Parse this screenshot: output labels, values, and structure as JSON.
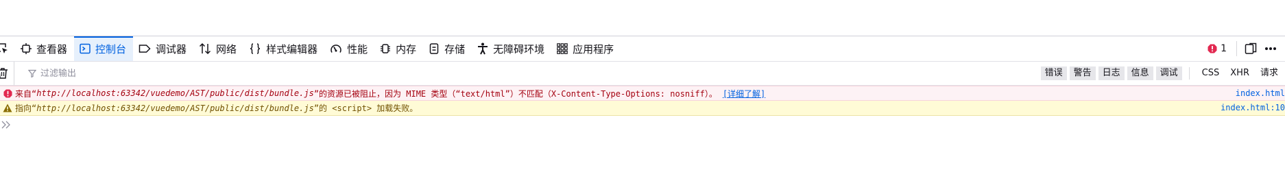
{
  "toolbar": {
    "tabs": [
      {
        "label": "查看器",
        "icon": "inspector-icon",
        "active": false
      },
      {
        "label": "控制台",
        "icon": "console-icon",
        "active": true
      },
      {
        "label": "调试器",
        "icon": "debugger-icon",
        "active": false
      },
      {
        "label": "网络",
        "icon": "network-icon",
        "active": false
      },
      {
        "label": "样式编辑器",
        "icon": "style-editor-icon",
        "active": false
      },
      {
        "label": "性能",
        "icon": "performance-icon",
        "active": false
      },
      {
        "label": "内存",
        "icon": "memory-icon",
        "active": false
      },
      {
        "label": "存储",
        "icon": "storage-icon",
        "active": false
      },
      {
        "label": "无障碍环境",
        "icon": "accessibility-icon",
        "active": false
      },
      {
        "label": "应用程序",
        "icon": "application-icon",
        "active": false
      }
    ],
    "error_count": "1"
  },
  "filter": {
    "placeholder": "过滤输出",
    "levels": [
      "错误",
      "警告",
      "日志",
      "信息",
      "调试"
    ],
    "requests": [
      "CSS",
      "XHR",
      "请求"
    ]
  },
  "messages": [
    {
      "level": "error",
      "prefix": "来自“",
      "url": "http://localhost:63342/vuedemo/AST/public/dist/bundle.js",
      "suffix": "”的资源已被阻止，因为 MIME 类型（“text/html”）不匹配（X-Content-Type-Options: nosniff）。",
      "link": "[详细了解]",
      "location": "index.html"
    },
    {
      "level": "warning",
      "prefix": "指向“",
      "url": "http://localhost:63342/vuedemo/AST/public/dist/bundle.js",
      "suffix": "”的 <script> 加载失败。",
      "location": "index.html:10"
    }
  ],
  "colors": {
    "accent": "#0061e0",
    "error_bg": "#fdf2f5",
    "error_text": "#a4000f",
    "warning_bg": "#fffbd6",
    "warning_text": "#715100"
  }
}
